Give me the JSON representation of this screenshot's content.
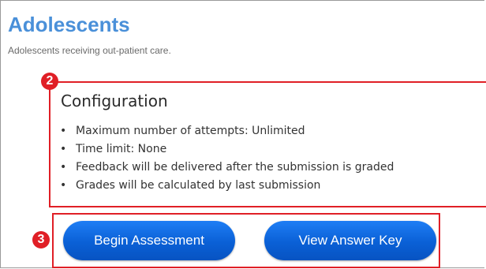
{
  "header": {
    "title": "Adolescents",
    "subtitle": "Adolescents receiving out-patient care."
  },
  "configuration": {
    "heading": "Configuration",
    "items": [
      "Maximum number of attempts: Unlimited",
      "Time limit: None",
      "Feedback will be delivered after the submission is graded",
      "Grades will be calculated by last submission"
    ]
  },
  "callouts": {
    "config_number": "2",
    "buttons_number": "3"
  },
  "actions": {
    "begin_label": "Begin Assessment",
    "answer_key_label": "View Answer Key"
  },
  "colors": {
    "title": "#4a90d9",
    "callout_red": "#e01f26",
    "button_blue": "#0a60d6"
  }
}
